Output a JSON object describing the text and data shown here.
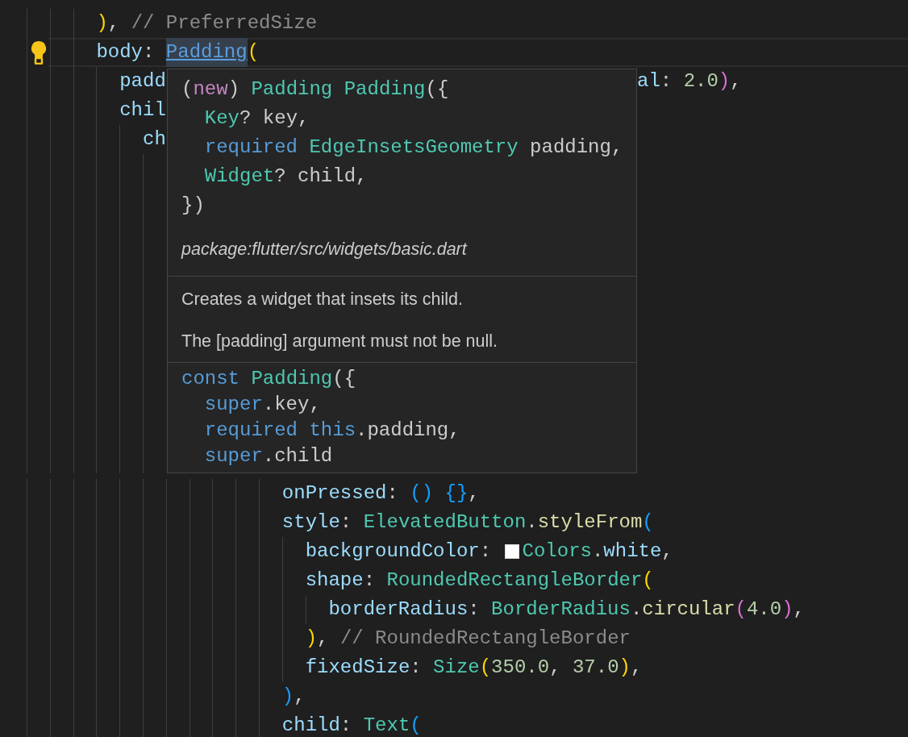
{
  "code": {
    "lines_above": [
      {
        "current": false,
        "bulb": false,
        "tokens": [
          {
            "kind": "paren1",
            "text": "      )"
          },
          {
            "kind": "punct",
            "text": ", "
          },
          {
            "kind": "comment",
            "text": "// PreferredSize"
          }
        ]
      },
      {
        "current": true,
        "bulb": true,
        "tokens": [
          {
            "kind": "prop",
            "text": "      body"
          },
          {
            "kind": "punct",
            "text": ": "
          },
          {
            "kind": "link",
            "text": "Padding"
          },
          {
            "kind": "paren1",
            "text": "("
          }
        ]
      },
      {
        "current": false,
        "bulb": false,
        "tokens": [
          {
            "kind": "prop",
            "text": "        padd"
          }
        ],
        "tail": [
          {
            "kind": "prop",
            "text": "al"
          },
          {
            "kind": "punct",
            "text": ": "
          },
          {
            "kind": "number",
            "text": "2.0"
          },
          {
            "kind": "paren2",
            "text": ")"
          },
          {
            "kind": "punct",
            "text": ","
          }
        ]
      },
      {
        "current": false,
        "bulb": false,
        "tokens": [
          {
            "kind": "prop",
            "text": "        chil"
          }
        ]
      },
      {
        "current": false,
        "bulb": false,
        "tokens": [
          {
            "kind": "prop",
            "text": "          ch"
          }
        ]
      }
    ],
    "lines_below": [
      {
        "current": false,
        "bulb": false,
        "tokens": [
          {
            "kind": "prop",
            "text": "                      onPressed"
          },
          {
            "kind": "punct",
            "text": ": "
          },
          {
            "kind": "paren3",
            "text": "()"
          },
          {
            "kind": "paren3",
            "text": " {}"
          },
          {
            "kind": "punct",
            "text": ","
          }
        ]
      },
      {
        "current": false,
        "bulb": false,
        "tokens": [
          {
            "kind": "prop",
            "text": "                      style"
          },
          {
            "kind": "punct",
            "text": ": "
          },
          {
            "kind": "type",
            "text": "ElevatedButton"
          },
          {
            "kind": "punct",
            "text": "."
          },
          {
            "kind": "func",
            "text": "styleFrom"
          },
          {
            "kind": "paren3",
            "text": "("
          }
        ]
      },
      {
        "current": false,
        "bulb": false,
        "tokens": [
          {
            "kind": "prop",
            "text": "                        backgroundColor"
          },
          {
            "kind": "punct",
            "text": ": "
          },
          {
            "kind": "swatch",
            "color": "#ffffff"
          },
          {
            "kind": "type",
            "text": "Colors"
          },
          {
            "kind": "punct",
            "text": "."
          },
          {
            "kind": "prop",
            "text": "white"
          },
          {
            "kind": "punct",
            "text": ","
          }
        ]
      },
      {
        "current": false,
        "bulb": false,
        "tokens": [
          {
            "kind": "prop",
            "text": "                        shape"
          },
          {
            "kind": "punct",
            "text": ": "
          },
          {
            "kind": "type",
            "text": "RoundedRectangleBorder"
          },
          {
            "kind": "paren1",
            "text": "("
          }
        ]
      },
      {
        "current": false,
        "bulb": false,
        "tokens": [
          {
            "kind": "prop",
            "text": "                          borderRadius"
          },
          {
            "kind": "punct",
            "text": ": "
          },
          {
            "kind": "type",
            "text": "BorderRadius"
          },
          {
            "kind": "punct",
            "text": "."
          },
          {
            "kind": "func",
            "text": "circular"
          },
          {
            "kind": "paren2",
            "text": "("
          },
          {
            "kind": "number",
            "text": "4.0"
          },
          {
            "kind": "paren2",
            "text": ")"
          },
          {
            "kind": "punct",
            "text": ","
          }
        ]
      },
      {
        "current": false,
        "bulb": false,
        "tokens": [
          {
            "kind": "paren1",
            "text": "                        )"
          },
          {
            "kind": "punct",
            "text": ", "
          },
          {
            "kind": "comment",
            "text": "// RoundedRectangleBorder"
          }
        ]
      },
      {
        "current": false,
        "bulb": false,
        "tokens": [
          {
            "kind": "prop",
            "text": "                        fixedSize"
          },
          {
            "kind": "punct",
            "text": ": "
          },
          {
            "kind": "type",
            "text": "Size"
          },
          {
            "kind": "paren1",
            "text": "("
          },
          {
            "kind": "number",
            "text": "350.0"
          },
          {
            "kind": "punct",
            "text": ", "
          },
          {
            "kind": "number",
            "text": "37.0"
          },
          {
            "kind": "paren1",
            "text": ")"
          },
          {
            "kind": "punct",
            "text": ","
          }
        ]
      },
      {
        "current": false,
        "bulb": false,
        "tokens": [
          {
            "kind": "paren3",
            "text": "                      )"
          },
          {
            "kind": "punct",
            "text": ","
          }
        ]
      },
      {
        "current": false,
        "bulb": false,
        "tokens": [
          {
            "kind": "prop",
            "text": "                      child"
          },
          {
            "kind": "punct",
            "text": ": "
          },
          {
            "kind": "type",
            "text": "Text"
          },
          {
            "kind": "paren3",
            "text": "("
          }
        ]
      }
    ]
  },
  "hover": {
    "signature": [
      [
        {
          "kind": "punct",
          "text": "("
        },
        {
          "kind": "control",
          "text": "new"
        },
        {
          "kind": "punct",
          "text": ") "
        },
        {
          "kind": "type",
          "text": "Padding"
        },
        {
          "kind": "type",
          "text": " Padding"
        },
        {
          "kind": "punct",
          "text": "({"
        }
      ],
      [
        {
          "kind": "type",
          "text": "  Key"
        },
        {
          "kind": "punct",
          "text": "? key,"
        }
      ],
      [
        {
          "kind": "keyword",
          "text": "  required"
        },
        {
          "kind": "type",
          "text": " EdgeInsetsGeometry"
        },
        {
          "kind": "punct",
          "text": " padding,"
        }
      ],
      [
        {
          "kind": "type",
          "text": "  Widget"
        },
        {
          "kind": "punct",
          "text": "? child,"
        }
      ],
      [
        {
          "kind": "punct",
          "text": "})"
        }
      ]
    ],
    "source": "package:flutter/src/widgets/basic.dart",
    "doc": [
      "Creates a widget that insets its child.",
      "The [padding] argument must not be null."
    ],
    "declaration": [
      [
        {
          "kind": "keyword",
          "text": "const"
        },
        {
          "kind": "type",
          "text": " Padding"
        },
        {
          "kind": "punct",
          "text": "({"
        }
      ],
      [
        {
          "kind": "keyword",
          "text": "  super"
        },
        {
          "kind": "punct",
          "text": ".key,"
        }
      ],
      [
        {
          "kind": "keyword",
          "text": "  required"
        },
        {
          "kind": "keyword",
          "text": " this"
        },
        {
          "kind": "punct",
          "text": ".padding,"
        }
      ],
      [
        {
          "kind": "keyword",
          "text": "  super"
        },
        {
          "kind": "punct",
          "text": ".child"
        }
      ]
    ]
  }
}
